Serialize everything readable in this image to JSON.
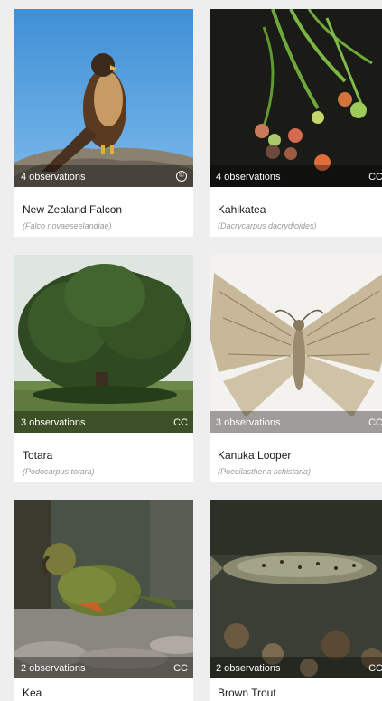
{
  "cards": [
    {
      "name": "New Zealand Falcon",
      "scientific": "(Falco novaeseelandiae)",
      "observations": "4 observations",
      "license": "©"
    },
    {
      "name": "Kahikatea",
      "scientific": "(Dacrycarpus dacrydioides)",
      "observations": "4 observations",
      "license": "CC"
    },
    {
      "name": "Totara",
      "scientific": "(Podocarpus totara)",
      "observations": "3 observations",
      "license": "CC"
    },
    {
      "name": "Kanuka Looper",
      "scientific": "(Poecilasthena schistaria)",
      "observations": "3 observations",
      "license": "CC"
    },
    {
      "name": "Kea",
      "scientific": "",
      "observations": "2 observations",
      "license": "CC"
    },
    {
      "name": "Brown Trout",
      "scientific": "",
      "observations": "2 observations",
      "license": "CC"
    }
  ]
}
